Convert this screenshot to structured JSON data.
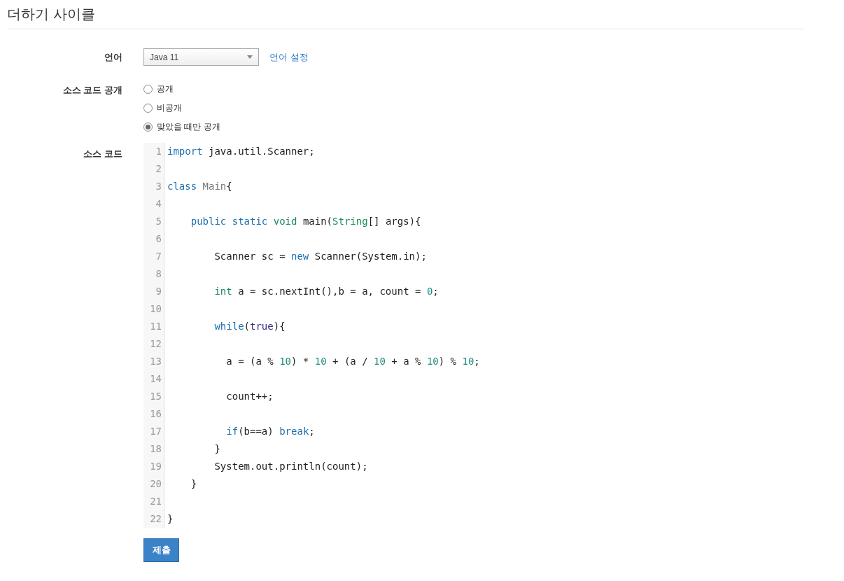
{
  "title": "더하기 사이클",
  "language": {
    "label": "언어",
    "value": "Java 11",
    "link": "언어 설정"
  },
  "visibility": {
    "label": "소스 코드 공개",
    "options": [
      {
        "label": "공개",
        "selected": false
      },
      {
        "label": "비공개",
        "selected": false
      },
      {
        "label": "맞았을 때만 공개",
        "selected": true
      }
    ]
  },
  "source": {
    "label": "소스 코드",
    "lines": [
      {
        "number": "1",
        "tokens": [
          {
            "kind": "keyword",
            "text": "import"
          },
          {
            "kind": "plain",
            "text": " java.util.Scanner;"
          }
        ]
      },
      {
        "number": "2"
      },
      {
        "number": "3",
        "tokens": [
          {
            "kind": "keyword",
            "text": "class"
          },
          {
            "kind": "def",
            "text": " Main"
          },
          {
            "kind": "plain",
            "text": "{"
          }
        ]
      },
      {
        "number": "4"
      },
      {
        "number": "5",
        "tokens": [
          {
            "kind": "keyword",
            "text": "    public"
          },
          {
            "kind": "keyword",
            "text": " static"
          },
          {
            "kind": "type",
            "text": " void"
          },
          {
            "kind": "plain",
            "text": " main("
          },
          {
            "kind": "type",
            "text": "String"
          },
          {
            "kind": "plain",
            "text": "[] args){"
          }
        ]
      },
      {
        "number": "6"
      },
      {
        "number": "7",
        "tokens": [
          {
            "kind": "plain",
            "text": "        Scanner sc = "
          },
          {
            "kind": "keyword",
            "text": "new"
          },
          {
            "kind": "plain",
            "text": " Scanner(System.in);"
          }
        ]
      },
      {
        "number": "8"
      },
      {
        "number": "9",
        "tokens": [
          {
            "kind": "type",
            "text": "        int"
          },
          {
            "kind": "plain",
            "text": " a = sc.nextInt(),b = a, count = "
          },
          {
            "kind": "number",
            "text": "0"
          },
          {
            "kind": "plain",
            "text": ";"
          }
        ]
      },
      {
        "number": "10"
      },
      {
        "number": "11",
        "tokens": [
          {
            "kind": "keyword",
            "text": "        while"
          },
          {
            "kind": "plain",
            "text": "("
          },
          {
            "kind": "atom",
            "text": "true"
          },
          {
            "kind": "plain",
            "text": "){"
          }
        ]
      },
      {
        "number": "12"
      },
      {
        "number": "13",
        "tokens": [
          {
            "kind": "plain",
            "text": "          a = (a % "
          },
          {
            "kind": "number",
            "text": "10"
          },
          {
            "kind": "plain",
            "text": ") * "
          },
          {
            "kind": "number",
            "text": "10"
          },
          {
            "kind": "plain",
            "text": " + (a / "
          },
          {
            "kind": "number",
            "text": "10"
          },
          {
            "kind": "plain",
            "text": " + a % "
          },
          {
            "kind": "number",
            "text": "10"
          },
          {
            "kind": "plain",
            "text": ") % "
          },
          {
            "kind": "number",
            "text": "10"
          },
          {
            "kind": "plain",
            "text": ";"
          }
        ]
      },
      {
        "number": "14"
      },
      {
        "number": "15",
        "tokens": [
          {
            "kind": "plain",
            "text": "          count++;"
          }
        ]
      },
      {
        "number": "16"
      },
      {
        "number": "17",
        "tokens": [
          {
            "kind": "keyword",
            "text": "          if"
          },
          {
            "kind": "plain",
            "text": "(b==a)"
          },
          {
            "kind": "keyword",
            "text": " break"
          },
          {
            "kind": "plain",
            "text": ";"
          }
        ]
      },
      {
        "number": "18",
        "tokens": [
          {
            "kind": "plain",
            "text": "        }"
          }
        ]
      },
      {
        "number": "19",
        "tokens": [
          {
            "kind": "plain",
            "text": "        System.out.println(count);"
          }
        ]
      },
      {
        "number": "20",
        "tokens": [
          {
            "kind": "plain",
            "text": "    }"
          }
        ]
      },
      {
        "number": "21"
      },
      {
        "number": "22",
        "tokens": [
          {
            "kind": "plain",
            "text": "}"
          }
        ]
      }
    ]
  },
  "submit": "제출"
}
